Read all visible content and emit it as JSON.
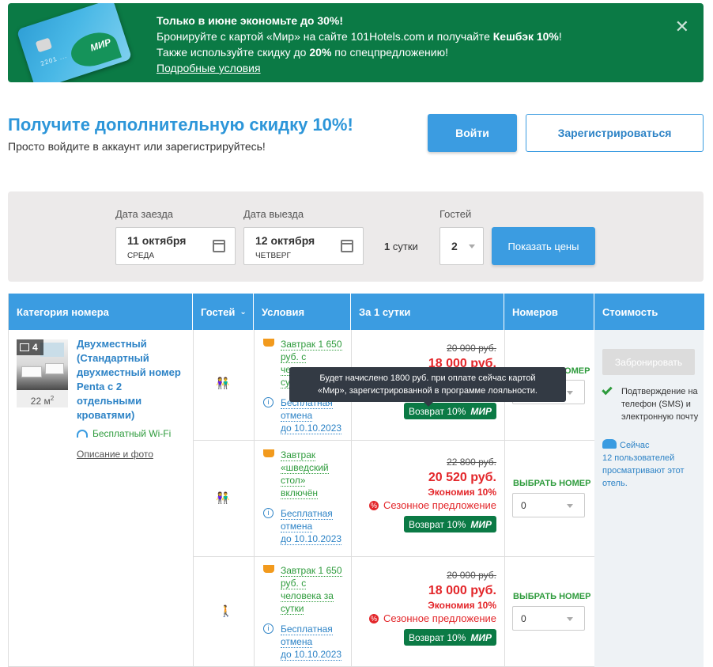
{
  "promo": {
    "line1": "Только в июне экономьте до 30%!",
    "line2_a": "Бронируйте с картой «Мир» на сайте 101Hotels.com и получайте ",
    "line2_b": "Кешбэк 10%",
    "line2_c": "!",
    "line3_a": "Также используйте скидку до ",
    "line3_b": "20%",
    "line3_c": " по спецпредложению!",
    "link": "Подробные условия",
    "card_brand": "МИР",
    "card_number": "2201 ...",
    "close_icon": "close-icon"
  },
  "login": {
    "title": "Получите дополнительную скидку 10%!",
    "subtitle": "Просто войдите в аккаунт или зарегистрируйтесь!",
    "login_label": "Войти",
    "register_label": "Зарегистрироваться"
  },
  "search": {
    "checkin_label": "Дата заезда",
    "checkin_date": "11 октября",
    "checkin_day": "СРЕДА",
    "checkout_label": "Дата выезда",
    "checkout_date": "12 октября",
    "checkout_day": "ЧЕТВЕРГ",
    "nights_value": "1",
    "nights_unit": "сутки",
    "guests_label": "Гостей",
    "guests_value": "2",
    "show_prices": "Показать цены"
  },
  "table": {
    "headers": {
      "category": "Категория номера",
      "guests": "Гостей",
      "conditions": "Условия",
      "per_night": "За 1 сутки",
      "rooms": "Номеров",
      "cost": "Стоимость"
    },
    "room": {
      "photo_count": "4",
      "area": "22 м",
      "area_sup": "2",
      "name": "Двухместный (Стандартный двухместный номер Penta с 2 отдельными кроватями)",
      "wifi": "Бесплатный Wi-Fi",
      "description_link": "Описание и фото"
    },
    "offers": [
      {
        "guests_icon": "two-persons-icon",
        "cond_food": "Завтрак 1 650 руб. с человека за сутки",
        "cond_cancel_a": "Бесплатная отмена",
        "cond_cancel_b": "до 10.10.2023",
        "old_price": "20 000 руб.",
        "new_price": "18 000 руб.",
        "economy": "",
        "season": "",
        "cashback": "Возврат 10%",
        "choose_label": "",
        "rooms_value": "0"
      },
      {
        "guests_icon": "two-persons-icon",
        "cond_food": "Завтрак «шведский стол» включён",
        "cond_cancel_a": "Бесплатная отмена",
        "cond_cancel_b": "до 10.10.2023",
        "old_price": "22 800 руб.",
        "new_price": "20 520 руб.",
        "economy": "Экономия 10%",
        "season": "Сезонное предложение",
        "cashback": "Возврат 10%",
        "choose_label": "ВЫБРАТЬ НОМЕР",
        "rooms_value": "0"
      },
      {
        "guests_icon": "one-person-icon",
        "cond_food": "Завтрак 1 650 руб. с человека за сутки",
        "cond_cancel_a": "Бесплатная отмена",
        "cond_cancel_b": "до 10.10.2023",
        "old_price": "20 000 руб.",
        "new_price": "18 000 руб.",
        "economy": "Экономия 10%",
        "season": "Сезонное предложение",
        "cashback": "Возврат 10%",
        "choose_label": "ВЫБРАТЬ НОМЕР",
        "rooms_value": "0"
      }
    ],
    "first_choose_label": "АТЬ НОМЕР",
    "booking": {
      "book_label": "Забронировать",
      "confirm": "Подтверждение на телефон (SMS) и электронную почту",
      "viewers_a": "Сейчас",
      "viewers_b": "12 пользователей просматривают этот отель."
    },
    "mir_label": "МИР"
  },
  "tooltip": {
    "line1": "Будет начислено 1800 руб. при оплате сейчас картой",
    "line2": "«Мир», зарегистрированной в программе лояльности."
  },
  "colors": {
    "brand_green": "#0b7a45",
    "primary_blue": "#3b9ce1",
    "price_red": "#e3262a",
    "text_green": "#2e9b3c"
  }
}
